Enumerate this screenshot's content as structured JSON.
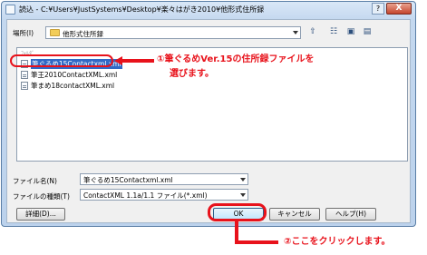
{
  "window": {
    "title": "読込 - C:¥Users¥JustSystems¥Desktop¥楽々はがき2010¥他形式住所録",
    "help_label": "?",
    "close_label": "X"
  },
  "location": {
    "label": "場所(I)",
    "value": "他形式住所録"
  },
  "toolbar": {
    "icons": [
      "up-folder-icon",
      "view-menu-icon",
      "new-folder-icon",
      "details-icon"
    ]
  },
  "file_list": {
    "folder_row_partial": "ﾌｫﾙﾀﾞ",
    "items": [
      {
        "name": "筆ぐるめ15Contactxml.xml",
        "selected": true
      },
      {
        "name": "筆王2010ContactXML.xml",
        "selected": false
      },
      {
        "name": "筆まめ18contactXML.xml",
        "selected": false
      }
    ]
  },
  "filename_field": {
    "label": "ファイル名(N)",
    "value": "筆ぐるめ15Contactxml.xml"
  },
  "filetype_field": {
    "label": "ファイルの種類(T)",
    "value": "ContactXML 1.1a/1.1 ファイル(*.xml)"
  },
  "buttons": {
    "details": "詳細(D)...",
    "ok": "OK",
    "cancel": "キャンセル",
    "help": "ヘルプ(H)"
  },
  "annotations": {
    "note1_line1": "①筆ぐるめVer.15の住所録ファイルを",
    "note1_line2": "選びます。",
    "note2": "②ここをクリックします。",
    "color": "#e8121b"
  }
}
